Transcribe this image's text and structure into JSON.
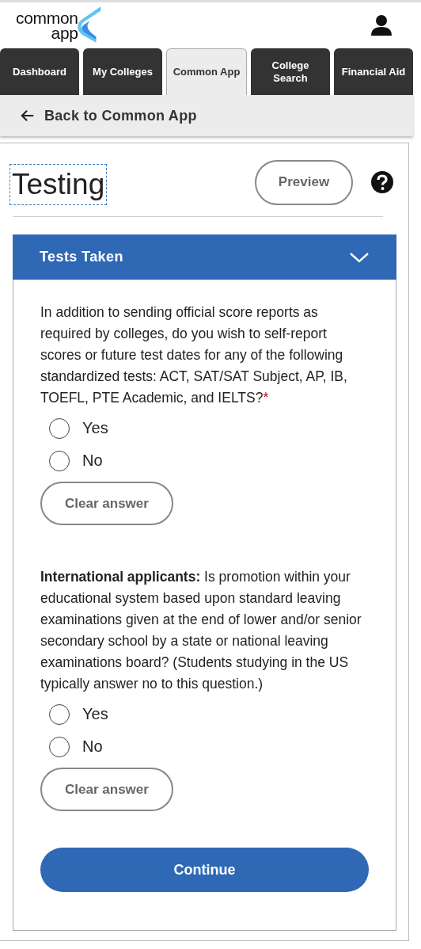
{
  "logo": {
    "line_1": "common",
    "line_2": "app"
  },
  "tabs": [
    {
      "label": "Dashboard",
      "selected": false
    },
    {
      "label": "My Colleges",
      "selected": false
    },
    {
      "label": "Common App",
      "selected": true
    },
    {
      "label": "College Search",
      "selected": false
    },
    {
      "label": "Financial Aid",
      "selected": false
    }
  ],
  "back_link": "Back to Common App",
  "page_title": "Testing",
  "preview_button": "Preview",
  "section": {
    "title": "Tests Taken",
    "expanded": true
  },
  "questions": [
    {
      "text": "In addition to sending official score reports as required by colleges, do you wish to self-report scores or future test dates for any of the following standardized tests: ACT, SAT/SAT Subject, AP, IB, TOEFL, PTE Academic, and IELTS?",
      "required_mark": "*",
      "options": [
        {
          "label": "Yes",
          "selected": false
        },
        {
          "label": "No",
          "selected": false
        }
      ],
      "clear_button": "Clear answer"
    },
    {
      "text": "**International applicants:** Is promotion within your educational system based upon standard leaving examinations given at the end of lower and/or senior secondary school by a state or national leaving examinations board? (Students studying in the US typically answer no to this question.)",
      "options": [
        {
          "label": "Yes",
          "selected": false
        },
        {
          "label": "No",
          "selected": false
        }
      ],
      "clear_button": "Clear answer"
    }
  ],
  "continue_button": "Continue"
}
